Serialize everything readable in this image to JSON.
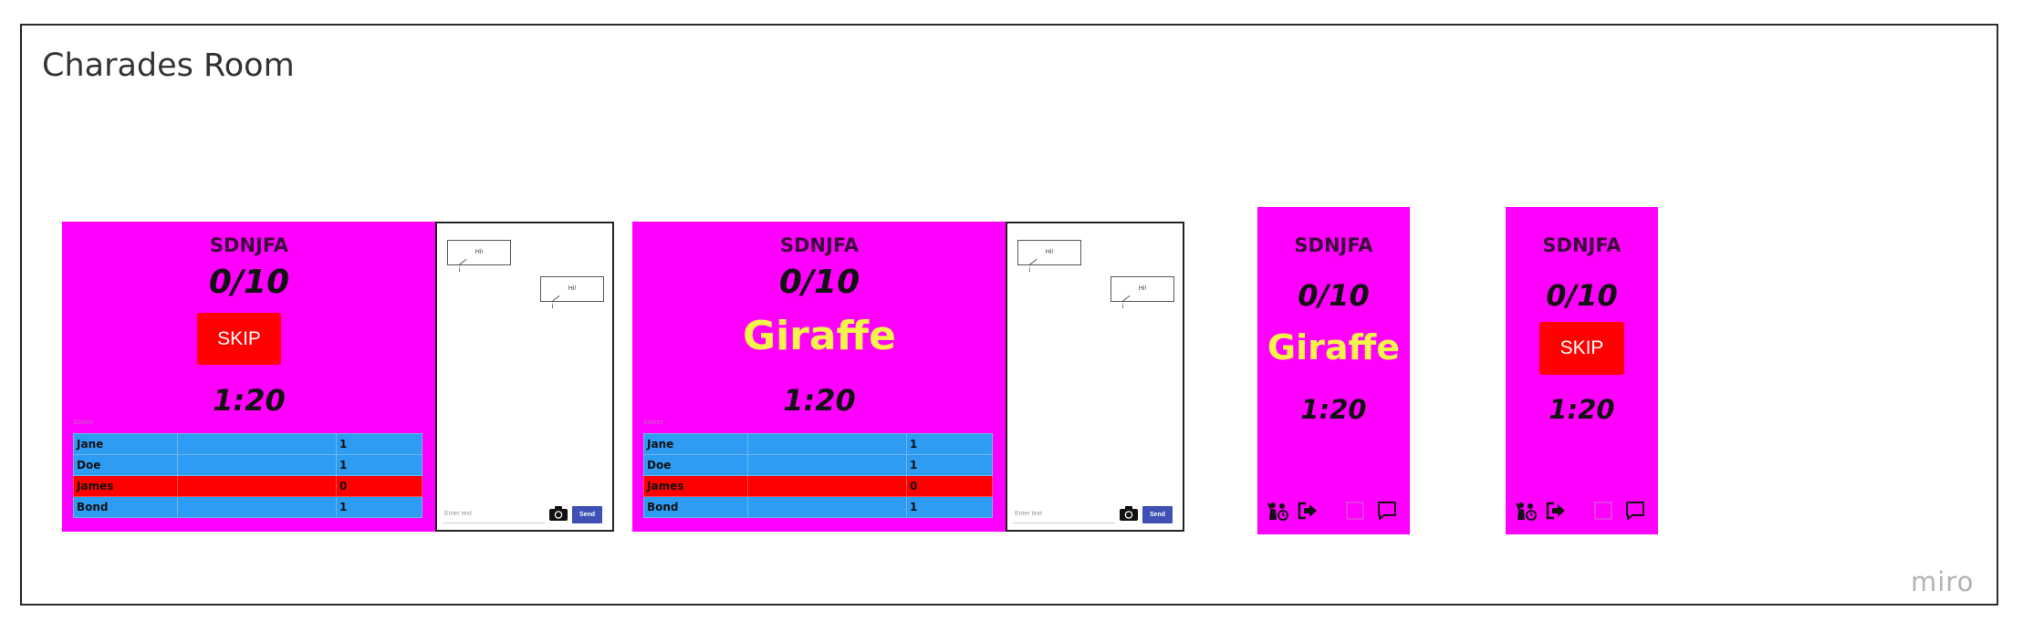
{
  "board": {
    "title": "Charades Room",
    "watermark": "miro"
  },
  "room": {
    "code": "SDNJFA",
    "score": "0/10",
    "timer": "1:20",
    "skip_label": "SKIP",
    "word": "Giraffe",
    "scores_label": "Scores"
  },
  "scoreboard": [
    {
      "name": "Jane",
      "points": "1",
      "highlight": false
    },
    {
      "name": "Doe",
      "points": "1",
      "highlight": false
    },
    {
      "name": "James",
      "points": "0",
      "highlight": true
    },
    {
      "name": "Bond",
      "points": "1",
      "highlight": false
    }
  ],
  "chat": {
    "messages": [
      "Hi!",
      "Hi!"
    ],
    "input_placeholder": "Enter text",
    "send_label": "Send"
  },
  "icons": [
    "charades-people-icon",
    "exit-arrow-icon",
    "blank-square-icon",
    "chat-bubble-icon"
  ],
  "colors": {
    "panel_bg": "#ff00ff",
    "skip_bg": "#ff0000",
    "word": "#f3f34a",
    "row_blue": "#2f9cf3",
    "row_red": "#ff0000",
    "send_bg": "#3f51b5"
  }
}
